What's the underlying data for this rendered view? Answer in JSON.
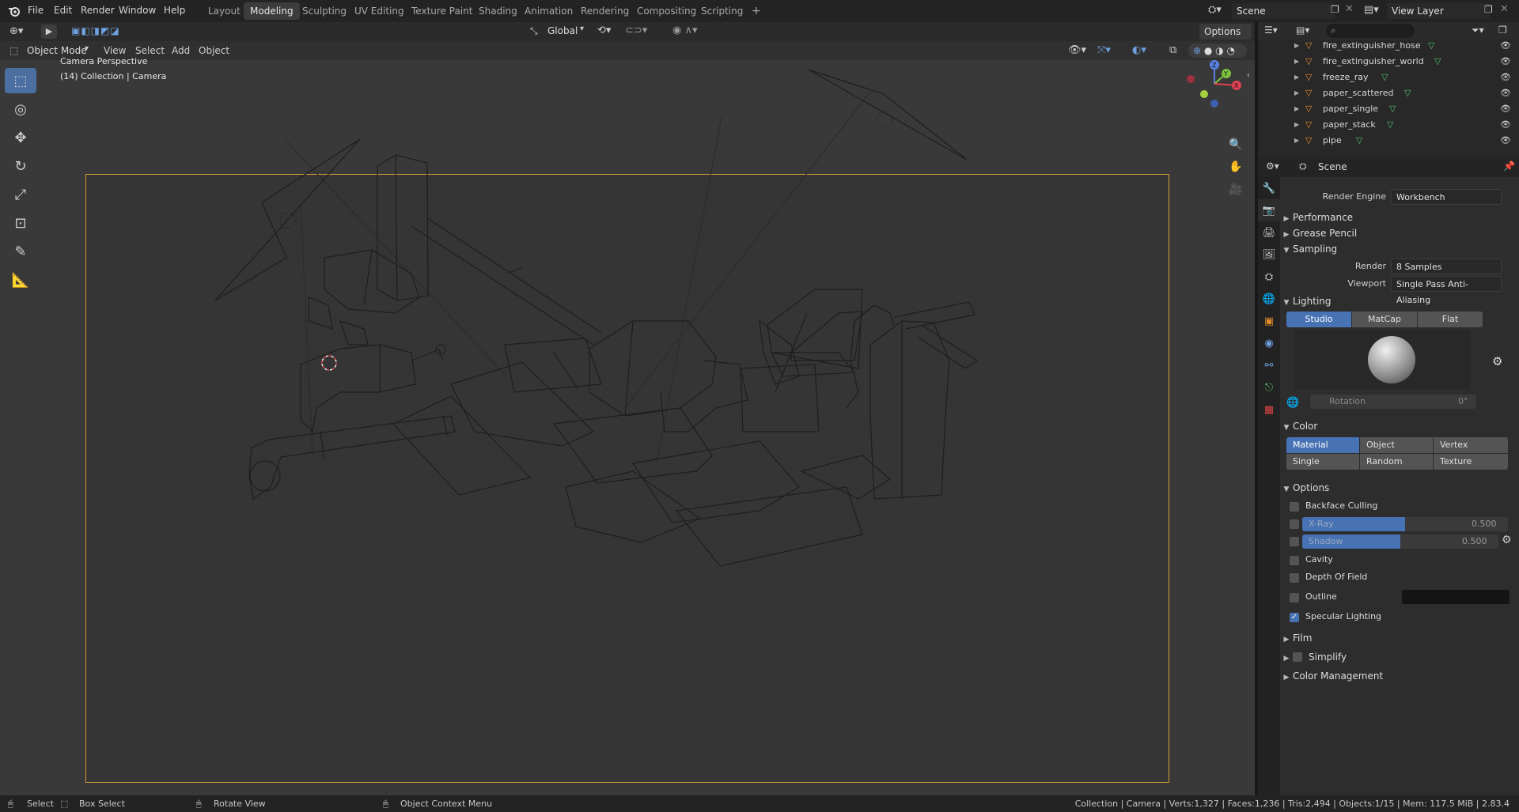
{
  "topbar": {
    "menus": [
      "File",
      "Edit",
      "Render",
      "Window",
      "Help"
    ],
    "workspaces": [
      "Layout",
      "Modeling",
      "Sculpting",
      "UV Editing",
      "Texture Paint",
      "Shading",
      "Animation",
      "Rendering",
      "Compositing",
      "Scripting"
    ],
    "active_workspace": "Modeling",
    "add_tab": "+",
    "scene": "Scene",
    "view_layer": "View Layer"
  },
  "viewport_header": {
    "transform_orientation": "Global",
    "options": "Options",
    "mode": "Object Mode",
    "menus": [
      "View",
      "Select",
      "Add",
      "Object"
    ]
  },
  "viewport": {
    "line1": "Camera Perspective",
    "line2": "(14) Collection | Camera"
  },
  "outliner": {
    "items": [
      {
        "name": "fire_extinguisher_hose"
      },
      {
        "name": "fire_extinguisher_world"
      },
      {
        "name": "freeze_ray"
      },
      {
        "name": "paper_scattered"
      },
      {
        "name": "paper_single"
      },
      {
        "name": "paper_stack"
      },
      {
        "name": "pipe"
      }
    ]
  },
  "properties": {
    "context": "Scene",
    "render_engine_label": "Render Engine",
    "render_engine": "Workbench",
    "sections": {
      "performance": "Performance",
      "grease_pencil": "Grease Pencil",
      "sampling": "Sampling",
      "lighting": "Lighting",
      "color": "Color",
      "options": "Options",
      "film": "Film",
      "simplify": "Simplify",
      "color_management": "Color Management"
    },
    "sampling": {
      "render_label": "Render",
      "render_value": "8 Samples",
      "viewport_label": "Viewport",
      "viewport_value": "Single Pass Anti-Aliasing"
    },
    "lighting": {
      "modes": [
        "Studio",
        "MatCap",
        "Flat"
      ],
      "active": "Studio",
      "rotation_label": "Rotation",
      "rotation_value": "0°"
    },
    "color": {
      "row1": [
        "Material",
        "Object",
        "Vertex"
      ],
      "row2": [
        "Single",
        "Random",
        "Texture"
      ],
      "active": "Material"
    },
    "options": {
      "backface_culling": {
        "label": "Backface Culling",
        "checked": false
      },
      "xray": {
        "label": "X-Ray",
        "value": "0.500",
        "fill": 0.5
      },
      "shadow": {
        "label": "Shadow",
        "value": "0.500",
        "fill": 0.5
      },
      "cavity": {
        "label": "Cavity",
        "checked": false
      },
      "depth_of_field": {
        "label": "Depth Of Field",
        "checked": false
      },
      "outline": {
        "label": "Outline",
        "checked": false
      },
      "specular_lighting": {
        "label": "Specular Lighting",
        "checked": true
      }
    }
  },
  "statusbar": {
    "select": "Select",
    "box_select": "Box Select",
    "rotate_view": "Rotate View",
    "context_menu": "Object Context Menu",
    "stats": "Collection | Camera | Verts:1,327 | Faces:1,236 | Tris:2,494 | Objects:1/15 | Mem: 117.5 MiB | 2.83.4"
  },
  "colors": {
    "accent": "#4772b3",
    "camera_frame": "#d59a3a",
    "mesh_icon": "#e08a2a",
    "vertex_icon": "#56c067"
  }
}
